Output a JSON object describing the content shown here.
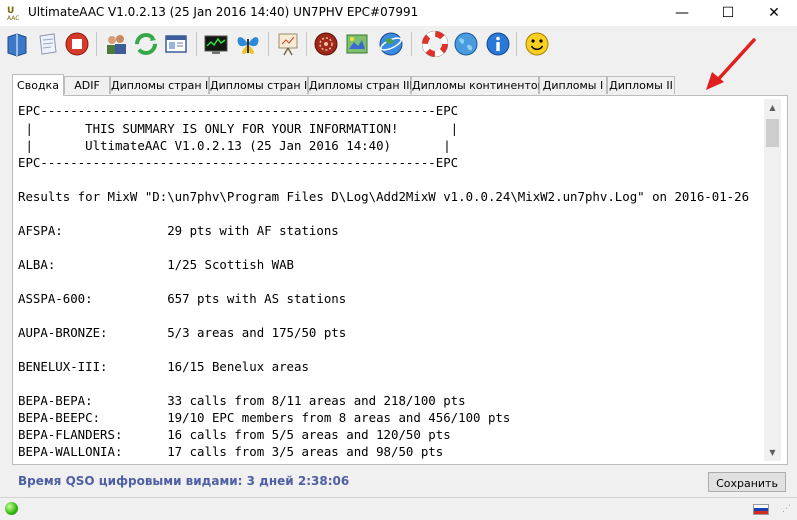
{
  "window": {
    "title": "UltimateAAC V1.0.2.13 (25 Jan 2016 14:40) UN7PHV EPC#07991",
    "min_glyph": "—",
    "max_glyph": "☐",
    "close_glyph": "✕"
  },
  "toolbar": {
    "buttons": [
      {
        "name": "book-icon"
      },
      {
        "name": "note-icon"
      },
      {
        "name": "stop-icon"
      },
      {
        "name": "users-icon"
      },
      {
        "name": "refresh-icon"
      },
      {
        "name": "window-icon"
      },
      {
        "name": "monitor-icon"
      },
      {
        "name": "butterfly-icon"
      },
      {
        "name": "presentation-icon"
      },
      {
        "name": "wheel-icon"
      },
      {
        "name": "award-icon"
      },
      {
        "name": "globe-google-icon"
      },
      {
        "name": "lifebuoy-icon"
      },
      {
        "name": "globe-icon"
      },
      {
        "name": "info-icon"
      },
      {
        "name": "smiley-icon"
      }
    ]
  },
  "tabs": [
    {
      "label": "Сводка",
      "active": true
    },
    {
      "label": "ADIF"
    },
    {
      "label": "Дипломы стран I"
    },
    {
      "label": "Дипломы стран II"
    },
    {
      "label": "Дипломы стран III"
    },
    {
      "label": "Дипломы континентов"
    },
    {
      "label": "Дипломы I"
    },
    {
      "label": "Дипломы II"
    }
  ],
  "summary": {
    "lines": [
      "EPC-----------------------------------------------------EPC",
      " |       THIS SUMMARY IS ONLY FOR YOUR INFORMATION!       |",
      " |       UltimateAAC V1.0.2.13 (25 Jan 2016 14:40)       |",
      "EPC-----------------------------------------------------EPC",
      "Results for MixW \"D:\\un7phv\\Program Files D\\Log\\Add2MixW v1.0.0.24\\MixW2.un7phv.Log\" on 2016-01-26",
      "AFSPA:              29 pts with AF stations",
      "ALBA:               1/25 Scottish WAB",
      "ASSPA-600:          657 pts with AS stations",
      "AUPA-BRONZE:        5/3 areas and 175/50 pts",
      "BENELUX-III:        16/15 Benelux areas",
      "BEPA-BEPA:          33 calls from 8/11 areas and 218/100 pts",
      "BEPA-BEEPC:         19/10 EPC members from 8 areas and 456/100 pts",
      "BEPA-FLANDERS:      16 calls from 5/5 areas and 120/50 pts",
      "BEPA-WALLONIA:      17 calls from 3/5 areas and 98/50 pts"
    ]
  },
  "footer": {
    "qso_time": "Время QSO цифровыми видами: 3 дней 2:38:06",
    "save_label": "Сохранить"
  },
  "colors": {
    "accent_text": "#4f5fa4",
    "arrow": "#e21f1f"
  }
}
